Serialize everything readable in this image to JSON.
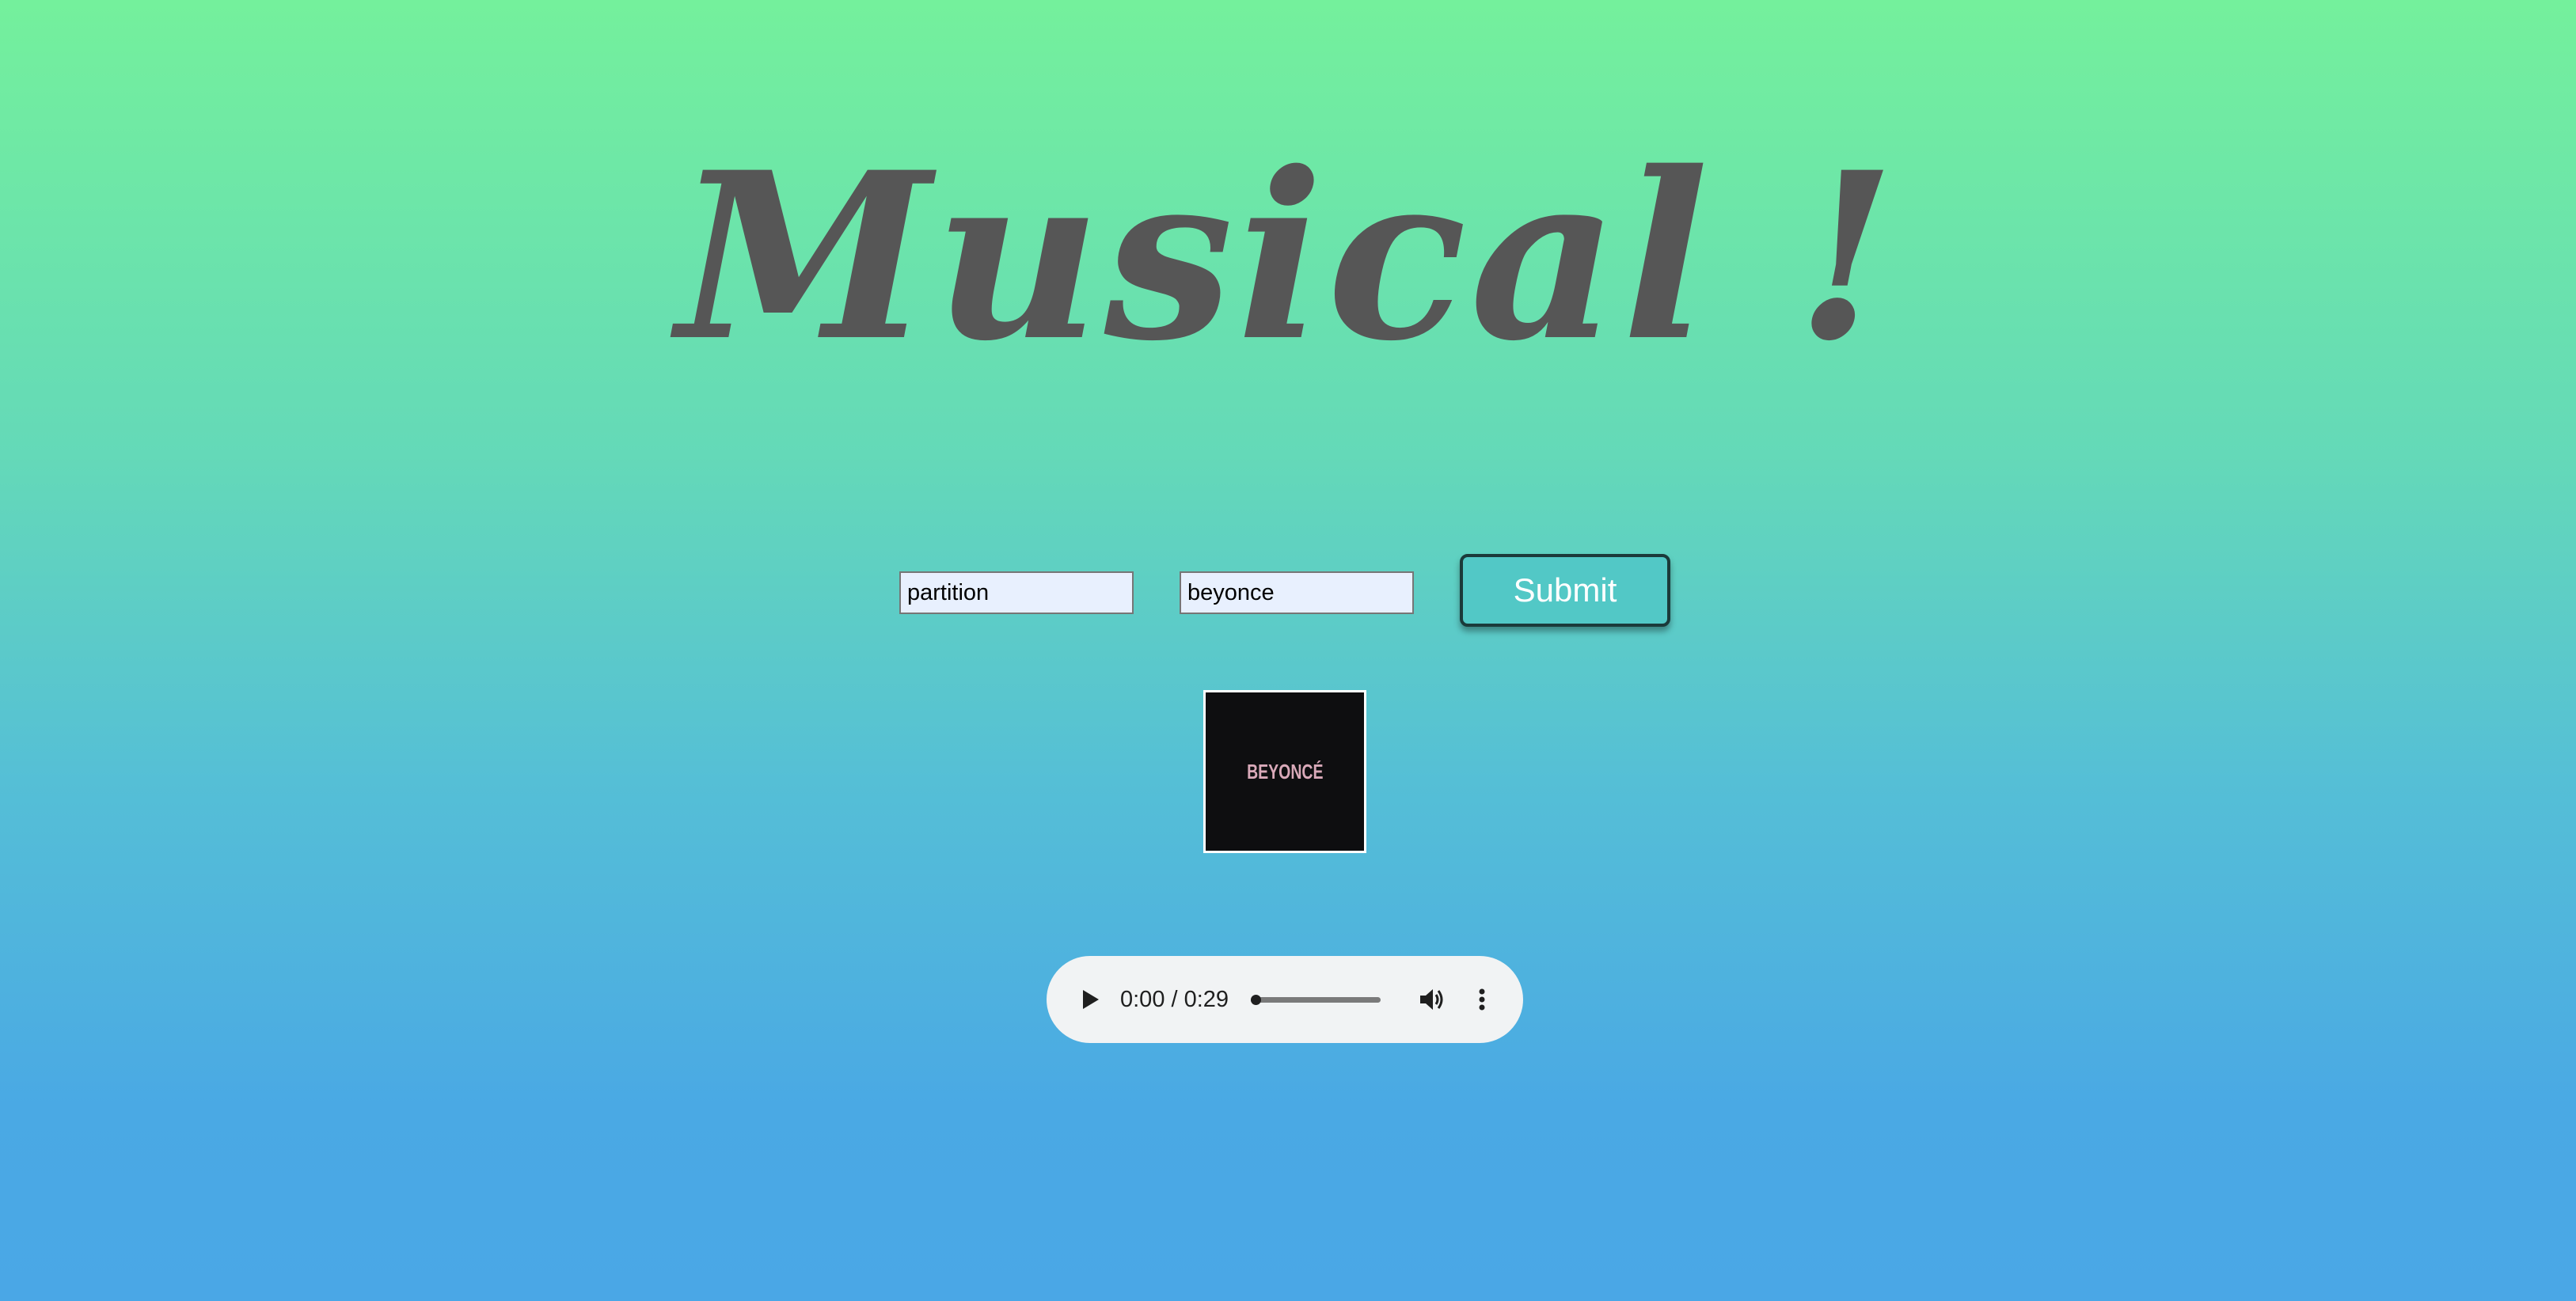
{
  "header": {
    "title": "Musical !"
  },
  "search_form": {
    "song_value": "partition",
    "artist_value": "beyonce",
    "submit_label": "Submit"
  },
  "album": {
    "cover_text": "BEYONCÉ"
  },
  "audio_player": {
    "time_display": "0:00 / 0:29",
    "progress": 0.0,
    "icons": [
      "play-icon",
      "volume-icon",
      "more-options-icon"
    ]
  },
  "colors": {
    "gradient_top": "#74f09c",
    "gradient_bottom": "#4aa7e6",
    "title_color": "#565656",
    "button_bg": "#52c8c6",
    "input_bg": "#e8f0fe",
    "player_bg": "#f1f3f4"
  }
}
